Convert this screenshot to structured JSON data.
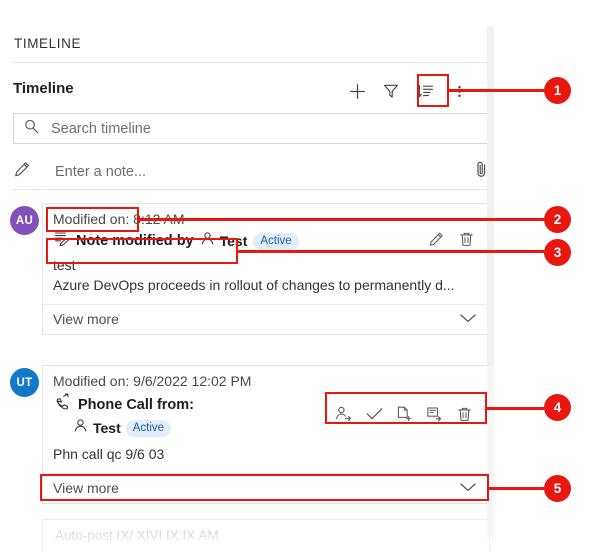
{
  "panel": {
    "title": "TIMELINE",
    "subheader": "Timeline",
    "toolbar": [
      {
        "name": "add-icon",
        "label": "Add"
      },
      {
        "name": "filter-icon",
        "label": "Filter"
      },
      {
        "name": "sort-icon",
        "label": "Sort"
      },
      {
        "name": "more-options-icon",
        "label": "More commands"
      }
    ],
    "search": {
      "placeholder": "Search timeline",
      "value": "",
      "icon": "search-icon"
    },
    "note_entry": {
      "placeholder": "Enter a note...",
      "value": "",
      "left_icon": "pencil-icon",
      "attach_icon": "paperclip-icon"
    }
  },
  "records": [
    {
      "avatar": {
        "initials": "AU",
        "color": "#8250b9"
      },
      "modified_on": "Modified on: 8:12 AM",
      "type_icon": "note-icon",
      "title": "Note modified by",
      "person_icon": "contact-icon",
      "person": "Test",
      "status": "Active",
      "actions": [
        {
          "name": "edit-icon",
          "label": "Edit"
        },
        {
          "name": "delete-icon",
          "label": "Delete"
        }
      ],
      "body": [
        "test",
        "Azure DevOps proceeds in rollout of changes to permanently d..."
      ],
      "view_more": "View more"
    },
    {
      "avatar": {
        "initials": "UT",
        "color": "#1079c8"
      },
      "modified_on": "Modified on: 9/6/2022 12:02 PM",
      "type_icon": "phone-icon",
      "title": "Phone Call from:",
      "person_icon": "contact-icon",
      "person": "Test",
      "status": "Active",
      "actions": [
        {
          "name": "assign-icon",
          "label": "Assign"
        },
        {
          "name": "check-icon",
          "label": "Mark complete"
        },
        {
          "name": "convert-to-case-icon",
          "label": "Convert to case"
        },
        {
          "name": "convert-to-opportunity-icon",
          "label": "Convert to opportunity"
        },
        {
          "name": "delete-icon",
          "label": "Delete"
        }
      ],
      "body": [
        "Phn call qc 9/6 03"
      ],
      "view_more": "View more"
    }
  ],
  "partial_record": {
    "text": "Auto-post  IX/ XIVI IX:IX AM"
  },
  "annotations": {
    "accent_color": "#e8170f",
    "callouts": [
      {
        "number": "1",
        "target": "sort-icon"
      },
      {
        "number": "2",
        "target": "modified-on-note"
      },
      {
        "number": "3",
        "target": "note-title-row"
      },
      {
        "number": "4",
        "target": "phonecall-actions"
      },
      {
        "number": "5",
        "target": "phonecall-view-more"
      }
    ]
  }
}
